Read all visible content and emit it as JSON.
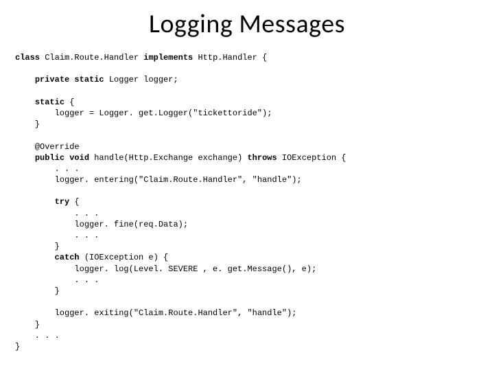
{
  "title": "Logging Messages",
  "code": {
    "l01a": "class",
    "l01b": " Claim.Route.Handler ",
    "l01c": "implements",
    "l01d": " Http.Handler {",
    "l02_indent": "    ",
    "l02a": "private static",
    "l02b": " Logger logger;",
    "l03a": "static",
    "l03b": " {",
    "l04": "        logger = Logger. get.Logger(\"tickettoride\");",
    "l05": "    }",
    "l06": "    @Override",
    "l07_indent": "    ",
    "l07a": "public void",
    "l07b": " handle(Http.Exchange exchange) ",
    "l07c": "throws",
    "l07d": " IOException {",
    "l08": "        . . .",
    "l09": "        logger. entering(\"Claim.Route.Handler\", \"handle\");",
    "l10_indent": "        ",
    "l10a": "try",
    "l10b": " {",
    "l11": "            . . .",
    "l12": "            logger. fine(req.Data);",
    "l13": "            . . .",
    "l14": "        }",
    "l15_indent": "        ",
    "l15a": "catch",
    "l15b": " (IOException e) {",
    "l16": "            logger. log(Level. SEVERE , e. get.Message(), e);",
    "l17": "            . . .",
    "l18": "        }",
    "l19": "        logger. exiting(\"Claim.Route.Handler\", \"handle\");",
    "l20": "    }",
    "l21": "    . . .",
    "l22": "}"
  }
}
